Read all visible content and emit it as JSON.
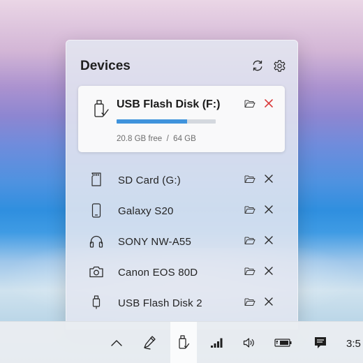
{
  "flyout": {
    "title": "Devices",
    "header_icons": [
      "refresh-icon",
      "gear-icon"
    ]
  },
  "active_device": {
    "name": "USB Flash Disk (F:)",
    "icon": "usb-drive-icon",
    "usage_fraction": 0.71,
    "free": "20.8 GB free",
    "separator": "/",
    "total": "64 GB",
    "storage_text": "20.8 GB free  /  64 GB",
    "colors": {
      "progress": "#3f93dc",
      "eject": "#d93a3a"
    }
  },
  "devices": [
    {
      "label": "SD Card (G:)",
      "icon": "sd-card-icon"
    },
    {
      "label": "Galaxy S20",
      "icon": "phone-icon"
    },
    {
      "label": "SONY NW-A55",
      "icon": "headphones-icon"
    },
    {
      "label": "Canon EOS 80D",
      "icon": "camera-icon"
    },
    {
      "label": "USB Flash Disk 2",
      "icon": "usb-drive-icon"
    }
  ],
  "taskbar": {
    "icons": [
      "chevron-up-icon",
      "pen-icon",
      "usb-drive-icon",
      "signal-icon",
      "volume-icon",
      "battery-icon",
      "notification-icon"
    ],
    "clock": "3:5"
  }
}
